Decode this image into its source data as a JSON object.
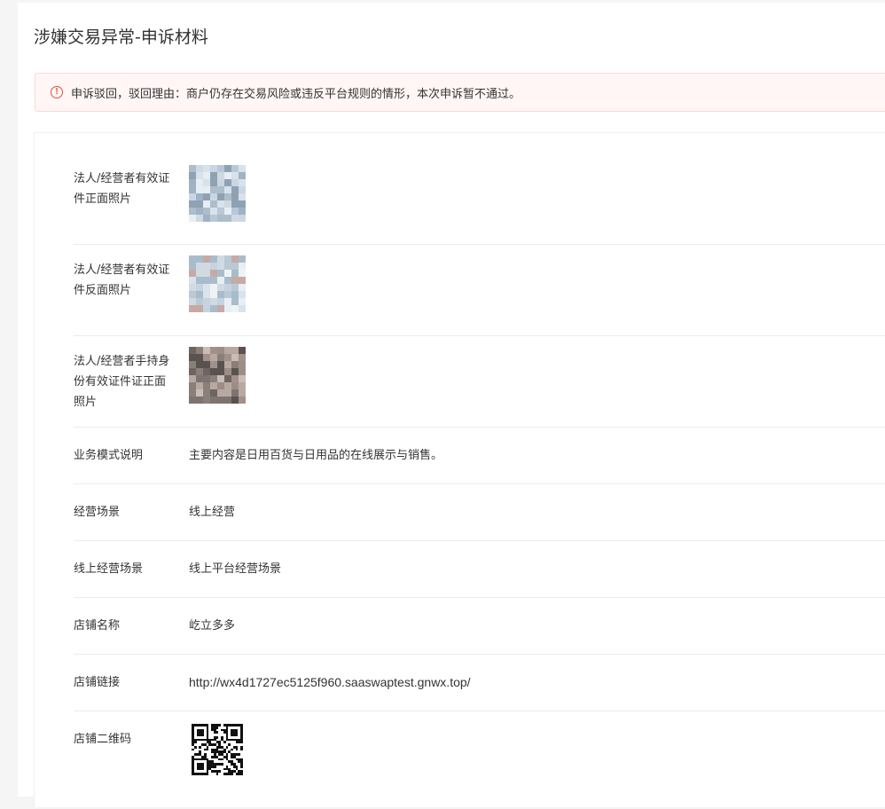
{
  "page": {
    "title": "涉嫌交易异常-申诉材料"
  },
  "alert": {
    "icon": "exclamation-circle-icon",
    "text": "申诉驳回，驳回理由：商户仍存在交易风险或违反平台规则的情形，本次申诉暂不通过。",
    "color": "#e74c3c"
  },
  "fields": {
    "id_front": {
      "label": "法人/经营者有效证件正面照片"
    },
    "id_back": {
      "label": "法人/经营者有效证件反面照片"
    },
    "id_handheld": {
      "label": "法人/经营者手持身份有效证件证正面照片"
    },
    "business_model": {
      "label": "业务模式说明",
      "value": "主要内容是日用百货与日用品的在线展示与销售。"
    },
    "scene": {
      "label": "经营场景",
      "value": "线上经营"
    },
    "online_scene": {
      "label": "线上经营场景",
      "value": "线上平台经营场景"
    },
    "store_name": {
      "label": "店铺名称",
      "value": "屹立多多"
    },
    "store_link": {
      "label": "店铺链接",
      "value": "http://wx4d1727ec5125f960.saaswaptest.gnwx.top/"
    },
    "store_qr": {
      "label": "店铺二维码"
    }
  }
}
